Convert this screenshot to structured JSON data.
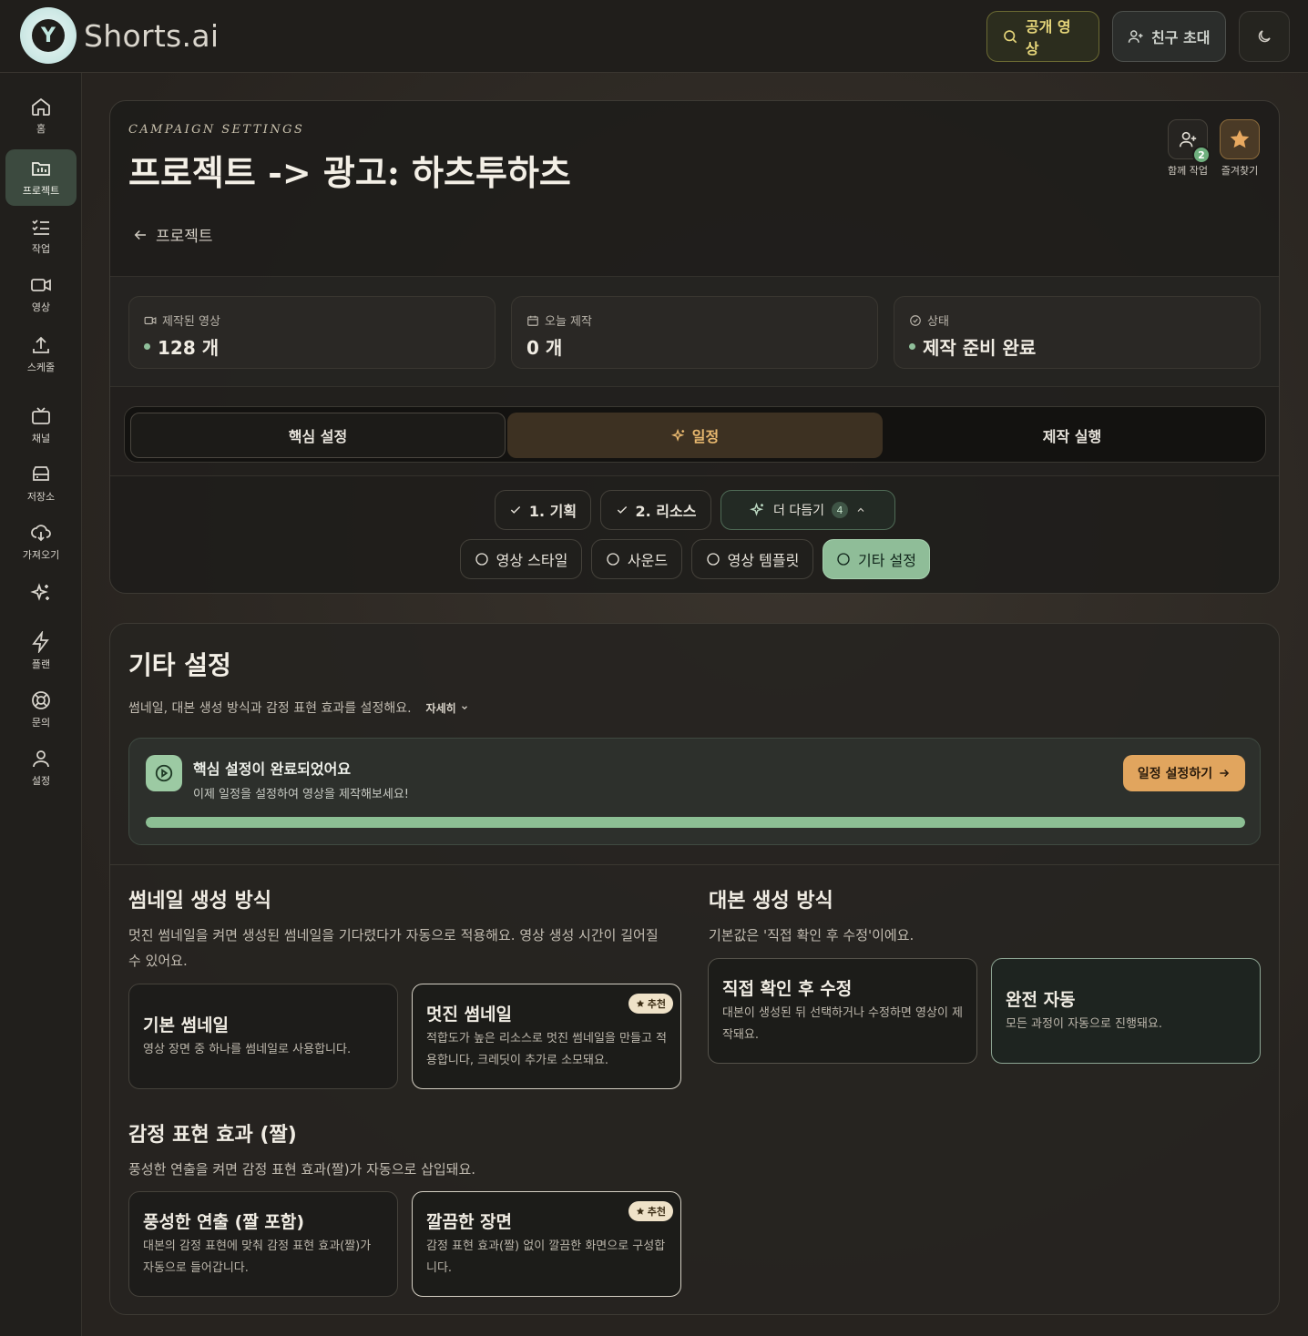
{
  "header": {
    "logo_text": "Shorts.ai",
    "logo_letter": "Y",
    "public_videos": "공개 영상",
    "invite_friends": "친구 초대"
  },
  "sidebar": {
    "items": [
      {
        "label": "홈",
        "icon": "home-icon"
      },
      {
        "label": "프로젝트",
        "icon": "project-icon"
      },
      {
        "label": "작업",
        "icon": "task-list-icon"
      },
      {
        "label": "영상",
        "icon": "video-icon"
      },
      {
        "label": "스케줄",
        "icon": "upload-icon"
      },
      {
        "label": "채널",
        "icon": "tv-icon"
      },
      {
        "label": "저장소",
        "icon": "storage-icon"
      },
      {
        "label": "가져오기",
        "icon": "cloud-download-icon"
      },
      {
        "label": "",
        "icon": "sparkles-icon"
      },
      {
        "label": "플랜",
        "icon": "bolt-icon"
      },
      {
        "label": "문의",
        "icon": "lifebuoy-icon"
      },
      {
        "label": "설정",
        "icon": "user-icon"
      }
    ]
  },
  "campaign": {
    "kicker": "CAMPAIGN SETTINGS",
    "title": "프로젝트 -> 광고: 하츠투하츠",
    "back_label": "프로젝트",
    "collab_label": "함께 작업",
    "collab_count": "2",
    "favorite_label": "즐겨찾기"
  },
  "stats": [
    {
      "label": "제작된 영상",
      "value": "128 개",
      "icon": "video-icon"
    },
    {
      "label": "오늘 제작",
      "value": "0 개",
      "icon": "calendar-icon"
    },
    {
      "label": "상태",
      "value": "제작 준비 완료",
      "icon": "check-circle-icon"
    }
  ],
  "tabs": [
    "핵심 설정",
    "일정",
    "제작 실행"
  ],
  "steps": {
    "step1": "1. 기획",
    "step2": "2. 리소스",
    "expand_label": "더 다듬기",
    "expand_count": "4",
    "sub": [
      "영상 스타일",
      "사운드",
      "영상 템플릿",
      "기타 설정"
    ]
  },
  "main": {
    "title": "기타 설정",
    "description": "썸네일, 대본 생성 방식과 감정 표현 효과를 설정해요.",
    "more_label": "자세히",
    "notice": {
      "title": "핵심 설정이 완료되었어요",
      "subtitle": "이제 일정을 설정하여 영상을 제작해보세요!",
      "button": "일정 설정하기",
      "progress": 1.0
    },
    "thumbnail": {
      "title": "썸네일 생성 방식",
      "desc": "멋진 썸네일을 켜면 생성된 썸네일을 기다렸다가 자동으로 적용해요. 영상 생성 시간이 길어질 수 있어요.",
      "options": [
        {
          "title": "기본 썸네일",
          "desc": "영상 장면 중 하나를 썸네일로 사용합니다."
        },
        {
          "title": "멋진 썸네일",
          "desc": "적합도가 높은 리소스로 멋진 썸네일을 만들고 적용합니다, 크레딧이 추가로 소모돼요.",
          "badge": "추천"
        }
      ]
    },
    "script": {
      "title": "대본 생성 방식",
      "desc": "기본값은 '직접 확인 후 수정'이에요.",
      "options": [
        {
          "title": "직접 확인 후 수정",
          "desc": "대본이 생성된 뒤 선택하거나 수정하면 영상이 제작돼요."
        },
        {
          "title": "완전 자동",
          "desc": "모든 과정이 자동으로 진행돼요."
        }
      ]
    },
    "emotion": {
      "title": "감정 표현 효과 (짤)",
      "desc": "풍성한 연출을 켜면 감정 표현 효과(짤)가 자동으로 삽입돼요.",
      "options": [
        {
          "title": "풍성한 연출 (짤 포함)",
          "desc": "대본의 감정 표현에 맞춰 감정 표현 효과(짤)가 자동으로 들어갑니다."
        },
        {
          "title": "깔끔한 장면",
          "desc": "감정 표현 효과(짤) 없이 깔끔한 화면으로 구성합니다.",
          "badge": "추천"
        }
      ]
    }
  }
}
